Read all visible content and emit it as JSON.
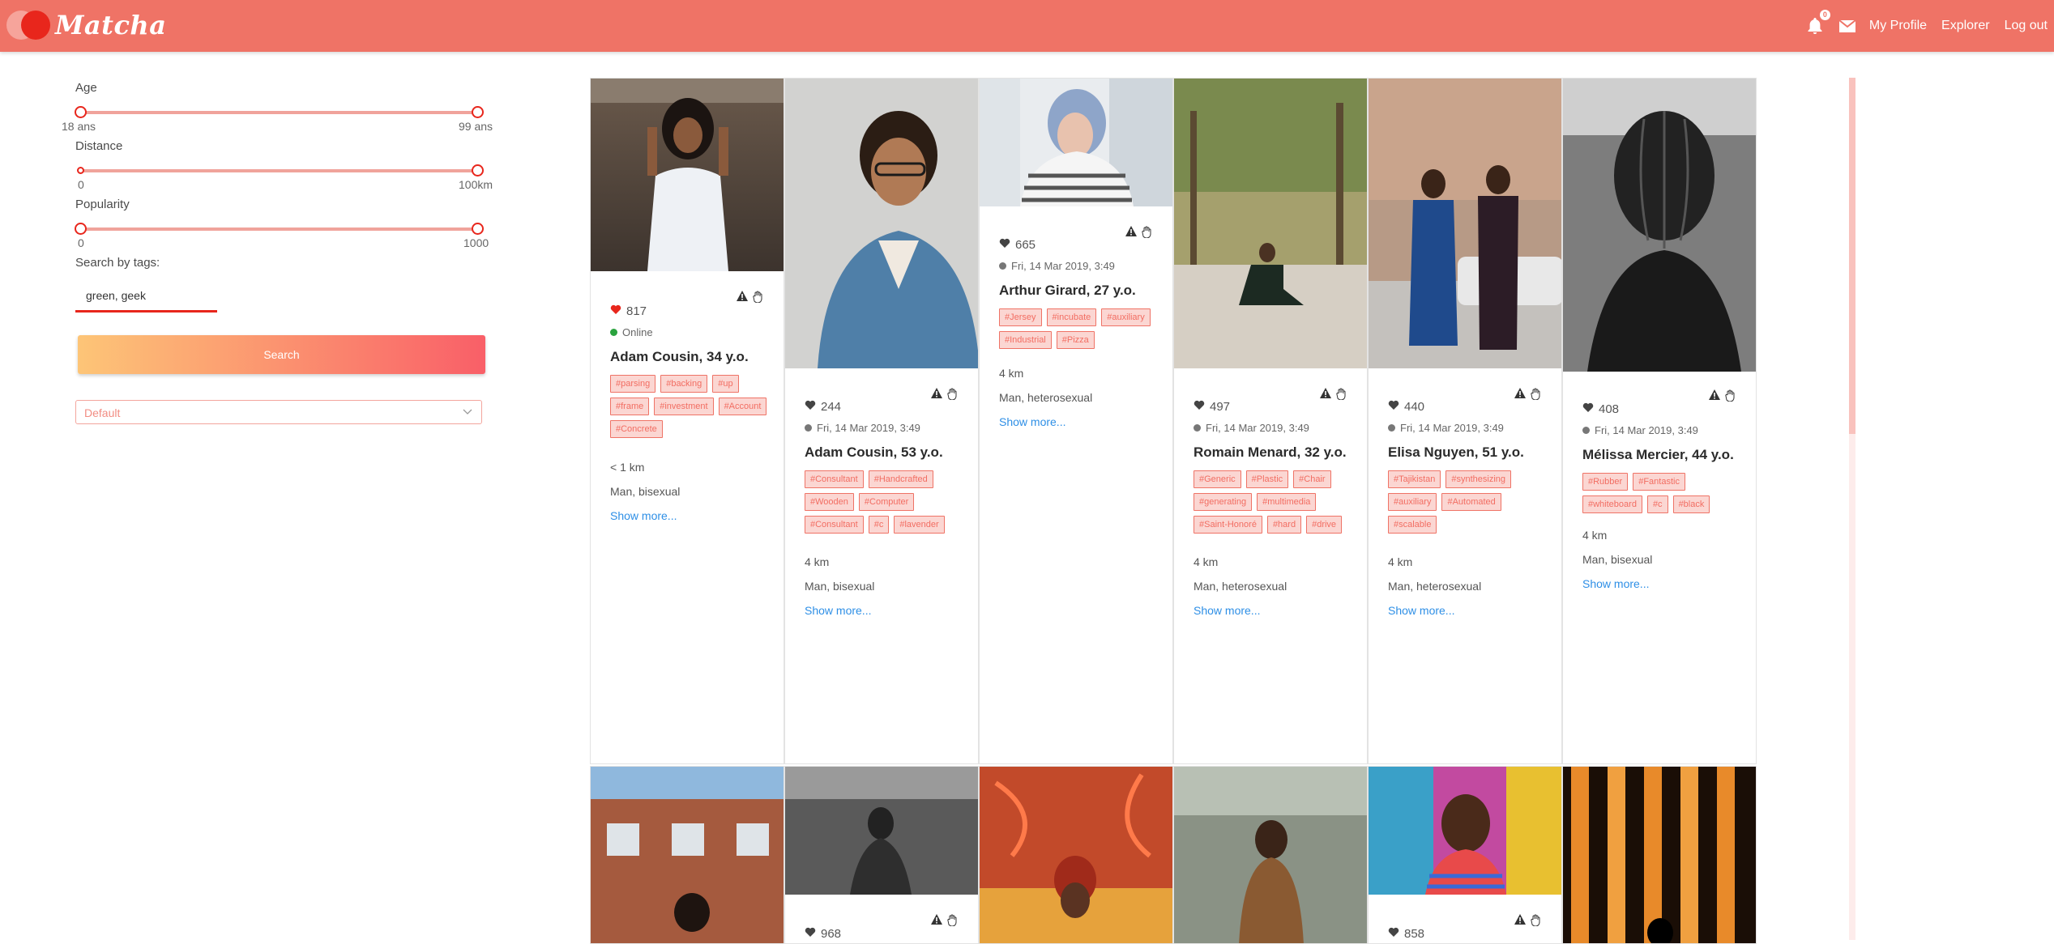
{
  "navbar": {
    "logo_text": "Matcha",
    "notification_count": "0",
    "links": {
      "profile": "My Profile",
      "explorer": "Explorer",
      "logout": "Log out"
    },
    "colors": {
      "bar": "#ef7366"
    }
  },
  "filters": {
    "age": {
      "label": "Age",
      "min_label": "18 ans",
      "max_label": "99 ans",
      "range": [
        18,
        99
      ]
    },
    "distance": {
      "label": "Distance",
      "min_label": "0",
      "max_label": "100km",
      "range": [
        0,
        100
      ]
    },
    "popularity": {
      "label": "Popularity",
      "min_label": "0",
      "max_label": "1000",
      "range": [
        0,
        1000
      ]
    },
    "tags_label": "Search by tags:",
    "tags_value": "green, geek",
    "search_label": "Search",
    "sort_value": "Default"
  },
  "profiles": [
    {
      "likes": "817",
      "liked": true,
      "status": "Online",
      "online": true,
      "name": "Adam Cousin, 34 y.o.",
      "tags": [
        "#parsing",
        "#backing",
        "#up",
        "#frame",
        "#investment",
        "#Account",
        "#Concrete"
      ],
      "distance": "< 1 km",
      "orientation": "Man, bisexual",
      "more": "Show more..."
    },
    {
      "likes": "244",
      "liked": false,
      "status": "Fri, 14 Mar 2019, 3:49",
      "online": false,
      "name": "Adam Cousin, 53 y.o.",
      "tags": [
        "#Consultant",
        "#Handcrafted",
        "#Wooden",
        "#Computer",
        "#Consultant",
        "#c",
        "#lavender"
      ],
      "distance": "4 km",
      "orientation": "Man, bisexual",
      "more": "Show more..."
    },
    {
      "likes": "665",
      "liked": false,
      "status": "Fri, 14 Mar 2019, 3:49",
      "online": false,
      "name": "Arthur Girard, 27 y.o.",
      "tags": [
        "#Jersey",
        "#incubate",
        "#auxiliary",
        "#Industrial",
        "#Pizza"
      ],
      "distance": "4 km",
      "orientation": "Man, heterosexual",
      "more": "Show more..."
    },
    {
      "likes": "497",
      "liked": false,
      "status": "Fri, 14 Mar 2019, 3:49",
      "online": false,
      "name": "Romain Menard, 32 y.o.",
      "tags": [
        "#Generic",
        "#Plastic",
        "#Chair",
        "#generating",
        "#multimedia",
        "#Saint-Honoré",
        "#hard",
        "#drive"
      ],
      "distance": "4 km",
      "orientation": "Man, heterosexual",
      "more": "Show more..."
    },
    {
      "likes": "440",
      "liked": false,
      "status": "Fri, 14 Mar 2019, 3:49",
      "online": false,
      "name": "Elisa Nguyen, 51 y.o.",
      "tags": [
        "#Tajikistan",
        "#synthesizing",
        "#auxiliary",
        "#Automated",
        "#scalable"
      ],
      "distance": "4 km",
      "orientation": "Man, heterosexual",
      "more": "Show more..."
    },
    {
      "likes": "408",
      "liked": false,
      "status": "Fri, 14 Mar 2019, 3:49",
      "online": false,
      "name": "Mélissa Mercier, 44 y.o.",
      "tags": [
        "#Rubber",
        "#Fantastic",
        "#whiteboard",
        "#c",
        "#black"
      ],
      "distance": "4 km",
      "orientation": "Man, bisexual",
      "more": "Show more..."
    }
  ],
  "profiles_row2": [
    {
      "likes": ""
    },
    {
      "likes": "968"
    },
    {
      "likes": ""
    },
    {
      "likes": ""
    },
    {
      "likes": "858"
    },
    {
      "likes": ""
    }
  ]
}
